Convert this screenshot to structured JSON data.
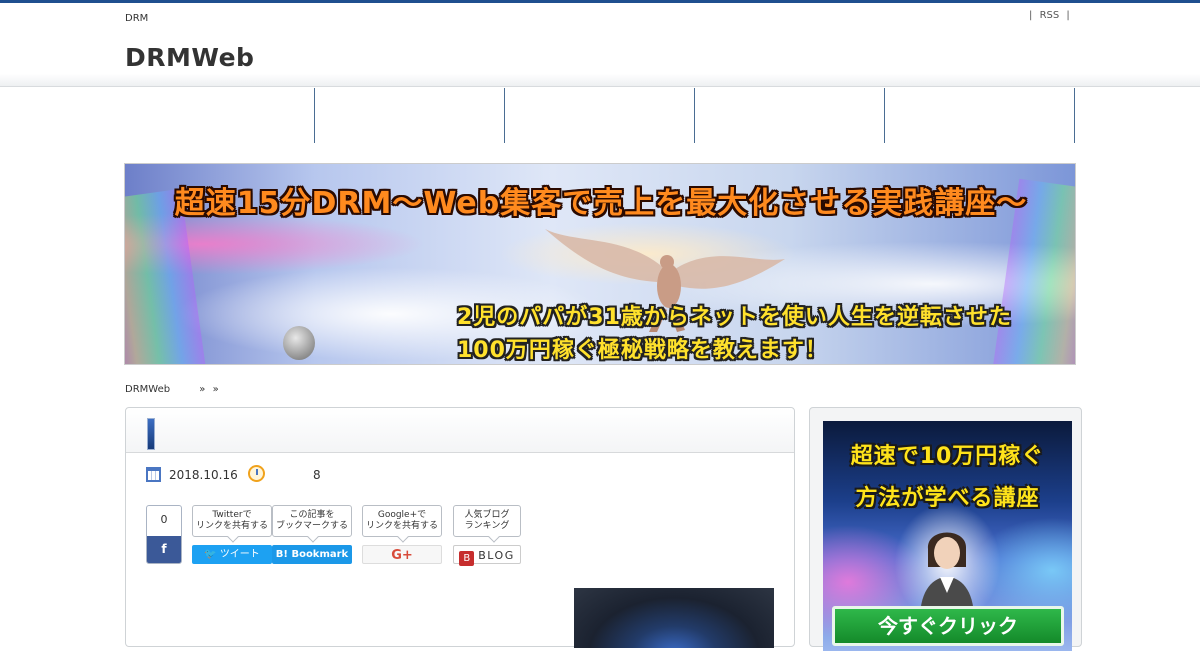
{
  "header": {
    "tagline": "DRM",
    "title": "DRMWeb",
    "rss_label": "RSS",
    "divider": "|"
  },
  "nav": {
    "items": [
      "",
      "",
      "",
      "",
      ""
    ]
  },
  "banner": {
    "title": "超速15分DRM〜Web集客で売上を最大化させる実践講座〜",
    "subtitle_line1": "2児のパパが31歳からネットを使い人生を逆転させた",
    "subtitle_line2": "100万円稼ぐ極秘戦略を教えます！"
  },
  "breadcrumb": {
    "home": "DRMWeb",
    "sep": "»"
  },
  "post": {
    "date": "2018.10.16",
    "count": "8"
  },
  "share": {
    "count": "0",
    "facebook_icon": "f",
    "twitter_bubble_line1": "Twitterで",
    "twitter_bubble_line2": "リンクを共有する",
    "twitter_button": "ツイート",
    "hatena_bubble_line1": "この記事を",
    "hatena_bubble_line2": "ブックマークする",
    "hatena_button": "B! Bookmark",
    "google_bubble_line1": "Google+で",
    "google_bubble_line2": "リンクを共有する",
    "google_button": "G+",
    "blog_bubble_line1": "人気ブログ",
    "blog_bubble_line2": "ランキング",
    "blog_button_icon": "B",
    "blog_button": "BLOG"
  },
  "sidebar_ad": {
    "line1": "超速で10万円稼ぐ",
    "line2": "方法が学べる講座",
    "cta": "今すぐクリック"
  },
  "colors": {
    "topbar": "#1f4f8f",
    "title_mark": "#173b79",
    "twitter": "#1da1f2",
    "facebook": "#3b5998",
    "hatena": "#1b98e8",
    "google": "#d84b3a"
  }
}
